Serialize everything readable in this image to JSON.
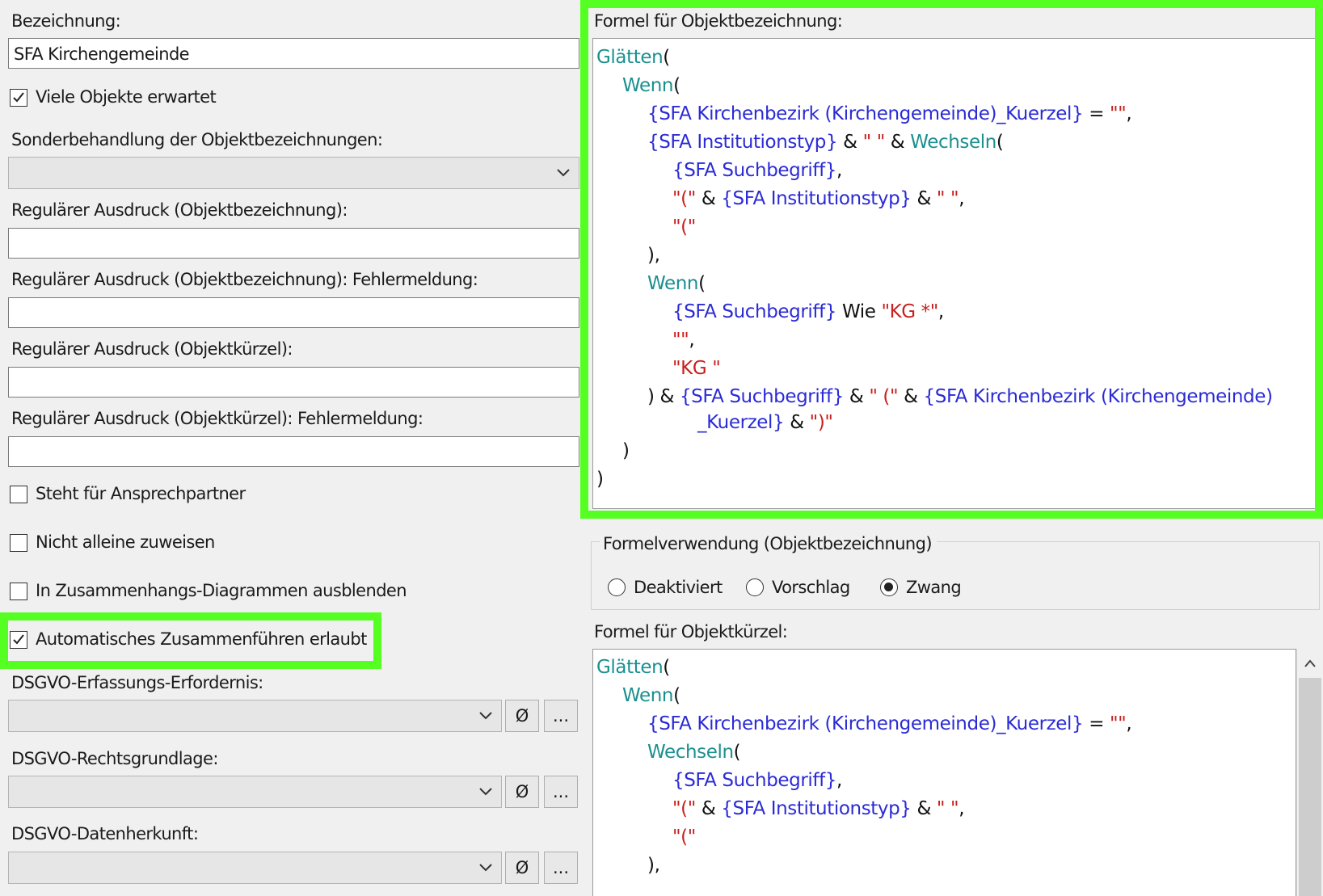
{
  "left": {
    "bezeichnung_label": "Bezeichnung:",
    "bezeichnung_value": "SFA Kirchengemeinde",
    "viele_objekte": "Viele Objekte erwartet",
    "sonderbehandlung_label": "Sonderbehandlung der Objektbezeichnungen:",
    "regex_bez_label": "Regulärer Ausdruck (Objektbezeichnung):",
    "regex_bez_err_label": "Regulärer Ausdruck (Objektbezeichnung): Fehlermeldung:",
    "regex_kuerzel_label": "Regulärer Ausdruck (Objektkürzel):",
    "regex_kuerzel_err_label": "Regulärer Ausdruck (Objektkürzel): Fehlermeldung:",
    "ansprechpartner": "Steht für Ansprechpartner",
    "nicht_alleine": "Nicht alleine zuweisen",
    "zusammenhang": "In Zusammenhangs-Diagrammen ausblenden",
    "auto_merge": "Automatisches Zusammenführen erlaubt",
    "dsgvo_erfassung_label": "DSGVO-Erfassungs-Erfordernis:",
    "dsgvo_rechts_label": "DSGVO-Rechtsgrundlage:",
    "dsgvo_herkunft_label": "DSGVO-Datenherkunft:",
    "clear_symbol": "Ø",
    "more_symbol": "..."
  },
  "right": {
    "formel_bez_label": "Formel für Objektbezeichnung:",
    "formel_verwendung_label": "Formelverwendung (Objektbezeichnung)",
    "radio_deaktiviert": "Deaktiviert",
    "radio_vorschlag": "Vorschlag",
    "radio_zwang": "Zwang",
    "formel_kuerzel_label": "Formel für Objektkürzel:"
  },
  "formula1": {
    "l1_fn": "Glätten",
    "l1_op": "(",
    "l2_fn": "Wenn",
    "l2_op": "(",
    "l3_fld": "{SFA Kirchenbezirk (Kirchengemeinde)_Kuerzel}",
    "l3_op": " = ",
    "l3_str": "\"\"",
    "l3_op2": ",",
    "l4_fld": "{SFA Institutionstyp}",
    "l4_op": " & ",
    "l4_str": "\" \"",
    "l4_op2": " & ",
    "l4_fn": "Wechseln",
    "l4_op3": "(",
    "l5_fld": "{SFA Suchbegriff}",
    "l5_op": ",",
    "l6_str": "\"(\"",
    "l6_op": " & ",
    "l6_fld": "{SFA Institutionstyp}",
    "l6_op2": " & ",
    "l6_str2": "\" \"",
    "l6_op3": ",",
    "l7_str": "\"(\"",
    "l8_op": "),",
    "l9_fn": "Wenn",
    "l9_op": "(",
    "l10_fld": "{SFA Suchbegriff}",
    "l10_op": " Wie ",
    "l10_str": "\"KG *\"",
    "l10_op2": ",",
    "l11_str": "\"\"",
    "l11_op": ",",
    "l12_str": "\"KG \"",
    "l13_op": ") & ",
    "l13_fld": "{SFA Suchbegriff}",
    "l13_op2": " & ",
    "l13_str": "\" (\"",
    "l13_op3": " & ",
    "l13_fld2": "{SFA Kirchenbezirk (Kirchengemeinde)",
    "l14_fld": "_Kuerzel}",
    "l14_op": " & ",
    "l14_str": "\")\"",
    "l15_op": ")",
    "l16_op": ")"
  },
  "formula2": {
    "l1_fn": "Glätten",
    "l1_op": "(",
    "l2_fn": "Wenn",
    "l2_op": "(",
    "l3_fld": "{SFA Kirchenbezirk (Kirchengemeinde)_Kuerzel}",
    "l3_op": " = ",
    "l3_str": "\"\"",
    "l3_op2": ",",
    "l4_fn": "Wechseln",
    "l4_op": "(",
    "l5_fld": "{SFA Suchbegriff}",
    "l5_op": ",",
    "l6_str": "\"(\"",
    "l6_op": " & ",
    "l6_fld": "{SFA Institutionstyp}",
    "l6_op2": " & ",
    "l6_str2": "\" \"",
    "l6_op3": ",",
    "l7_str": "\"(\"",
    "l8_op": "),"
  },
  "colors": {
    "highlight": "#55ff22",
    "function": "#1b8f8f",
    "field": "#2b2bd6",
    "string": "#c8201f"
  }
}
